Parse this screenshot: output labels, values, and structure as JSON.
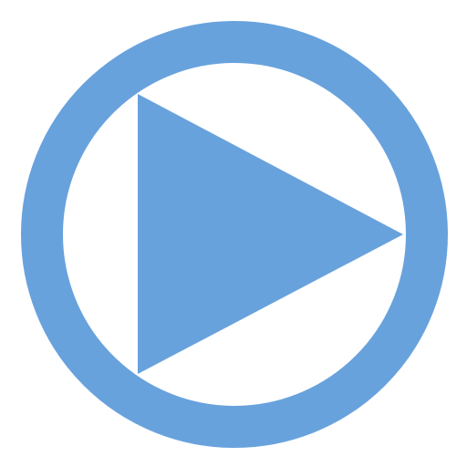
{
  "icon": {
    "name": "play-circle-icon",
    "accent_color": "#68a2dd",
    "background_color": "#ffffff"
  }
}
